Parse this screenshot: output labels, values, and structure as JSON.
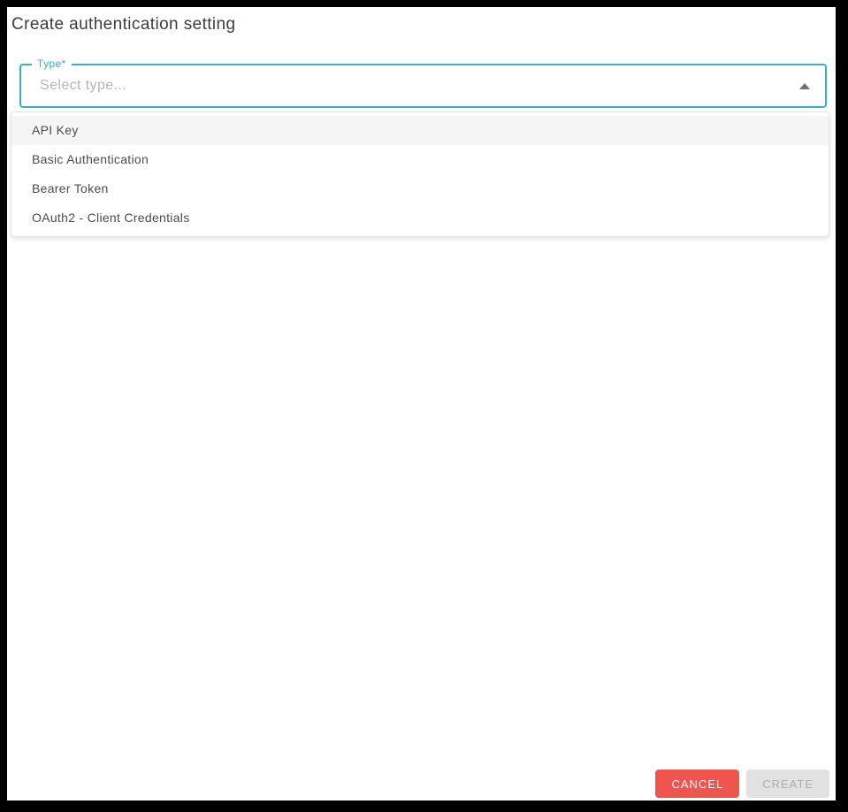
{
  "dialog": {
    "title": "Create authentication setting"
  },
  "type_field": {
    "label": "Type*",
    "placeholder": "Select type...",
    "state": "open",
    "caret_icon": "caret-up",
    "accent_color": "#38afc9"
  },
  "dropdown": {
    "options": [
      {
        "label": "API Key",
        "highlighted": true
      },
      {
        "label": "Basic Authentication",
        "highlighted": false
      },
      {
        "label": "Bearer Token",
        "highlighted": false
      },
      {
        "label": "OAuth2 - Client Credentials",
        "highlighted": false
      }
    ]
  },
  "footer": {
    "cancel_label": "CANCEL",
    "create_label": "CREATE",
    "cancel_color": "#f0544f",
    "create_disabled": true
  }
}
